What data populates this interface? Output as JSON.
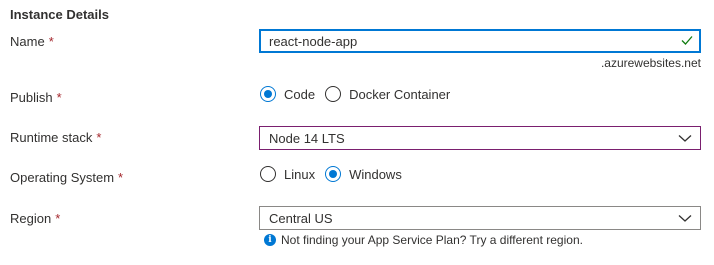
{
  "section": {
    "title": "Instance Details"
  },
  "fields": {
    "name": {
      "label": "Name",
      "required": "*",
      "value": "react-node-app",
      "suffix": ".azurewebsites.net",
      "valid_icon": "check-icon"
    },
    "publish": {
      "label": "Publish",
      "required": "*",
      "options": [
        "Code",
        "Docker Container"
      ],
      "selected": "Code"
    },
    "runtime": {
      "label": "Runtime stack",
      "required": "*",
      "value": "Node 14 LTS"
    },
    "os": {
      "label": "Operating System",
      "required": "*",
      "options": [
        "Linux",
        "Windows"
      ],
      "selected": "Windows"
    },
    "region": {
      "label": "Region",
      "required": "*",
      "value": "Central US",
      "hint": "Not finding your App Service Plan? Try a different region.",
      "hint_icon": "info-icon"
    }
  },
  "colors": {
    "accent": "#0078d4",
    "required": "#a4262c",
    "success": "#107c10",
    "focus_border": "#7a1f6f"
  }
}
